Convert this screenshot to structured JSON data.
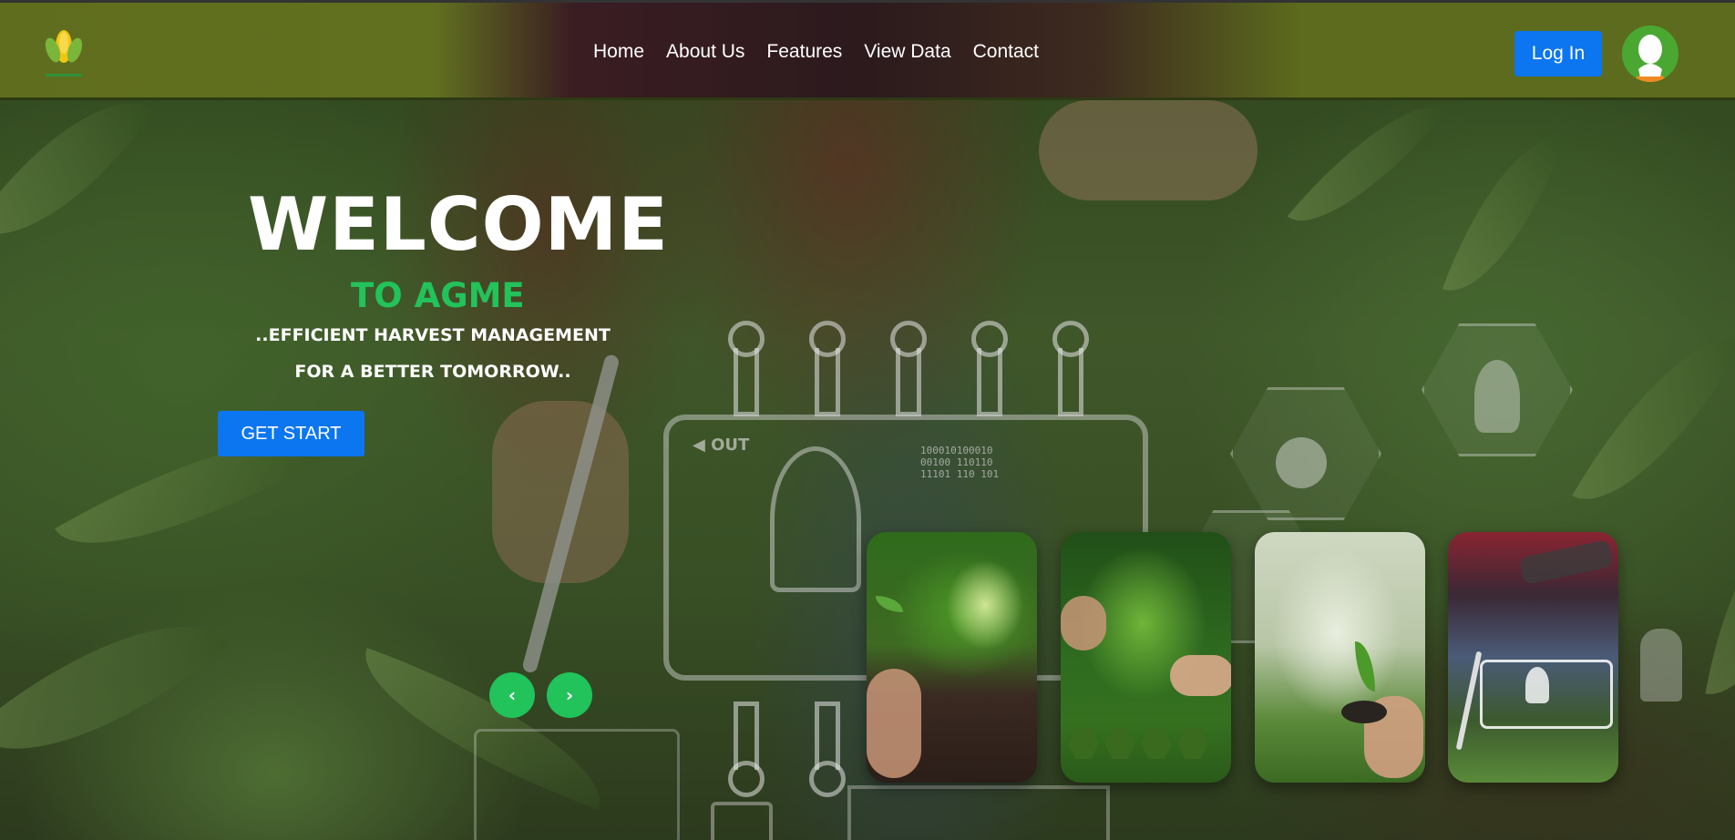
{
  "navbar": {
    "links": [
      "Home",
      "About Us",
      "Features",
      "View Data",
      "Contact"
    ],
    "login_label": "Log In",
    "logo_icon": "corn-logo-icon",
    "avatar_icon": "user-avatar-icon"
  },
  "hero": {
    "title": "WELCOME",
    "subtitle": "TO AGME",
    "tagline": "..EFFICIENT HARVEST MANAGEMENT FOR A BETTER TOMORROW..",
    "cta_label": "GET START",
    "prev_label": "‹",
    "next_label": "›"
  },
  "cards": [
    {
      "icon": "seedling-in-soil-image"
    },
    {
      "icon": "plant-in-hands-image"
    },
    {
      "icon": "chemistry-seedling-image"
    },
    {
      "icon": "farmer-tablet-image"
    }
  ],
  "colors": {
    "accent_blue": "#0b76f0",
    "accent_green": "#22c35a",
    "navbar_olive": "#5f6e1e"
  }
}
